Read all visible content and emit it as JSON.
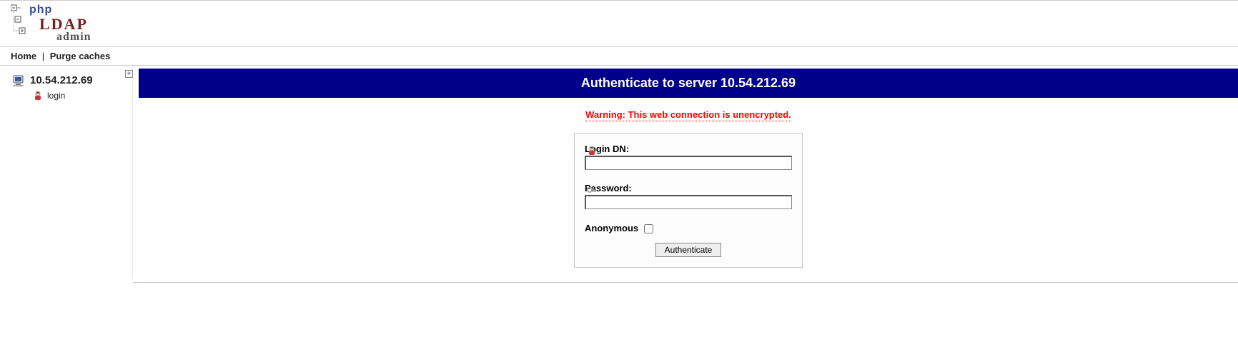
{
  "logo": {
    "php": "php",
    "ldap": "LDAP",
    "admin": "admin"
  },
  "nav": {
    "home": "Home",
    "purge": "Purge caches",
    "sep": "|"
  },
  "sidebar": {
    "server_ip": "10.54.212.69",
    "login_label": "login",
    "expand_symbol": "+"
  },
  "main": {
    "title": "Authenticate to server 10.54.212.69",
    "warning": "Warning: This web connection is unencrypted.",
    "login_dn_label": "Login DN:",
    "login_dn_value": "",
    "password_label": "Password:",
    "password_value": "",
    "anonymous_label": "Anonymous",
    "anonymous_checked": false,
    "submit_label": "Authenticate"
  }
}
